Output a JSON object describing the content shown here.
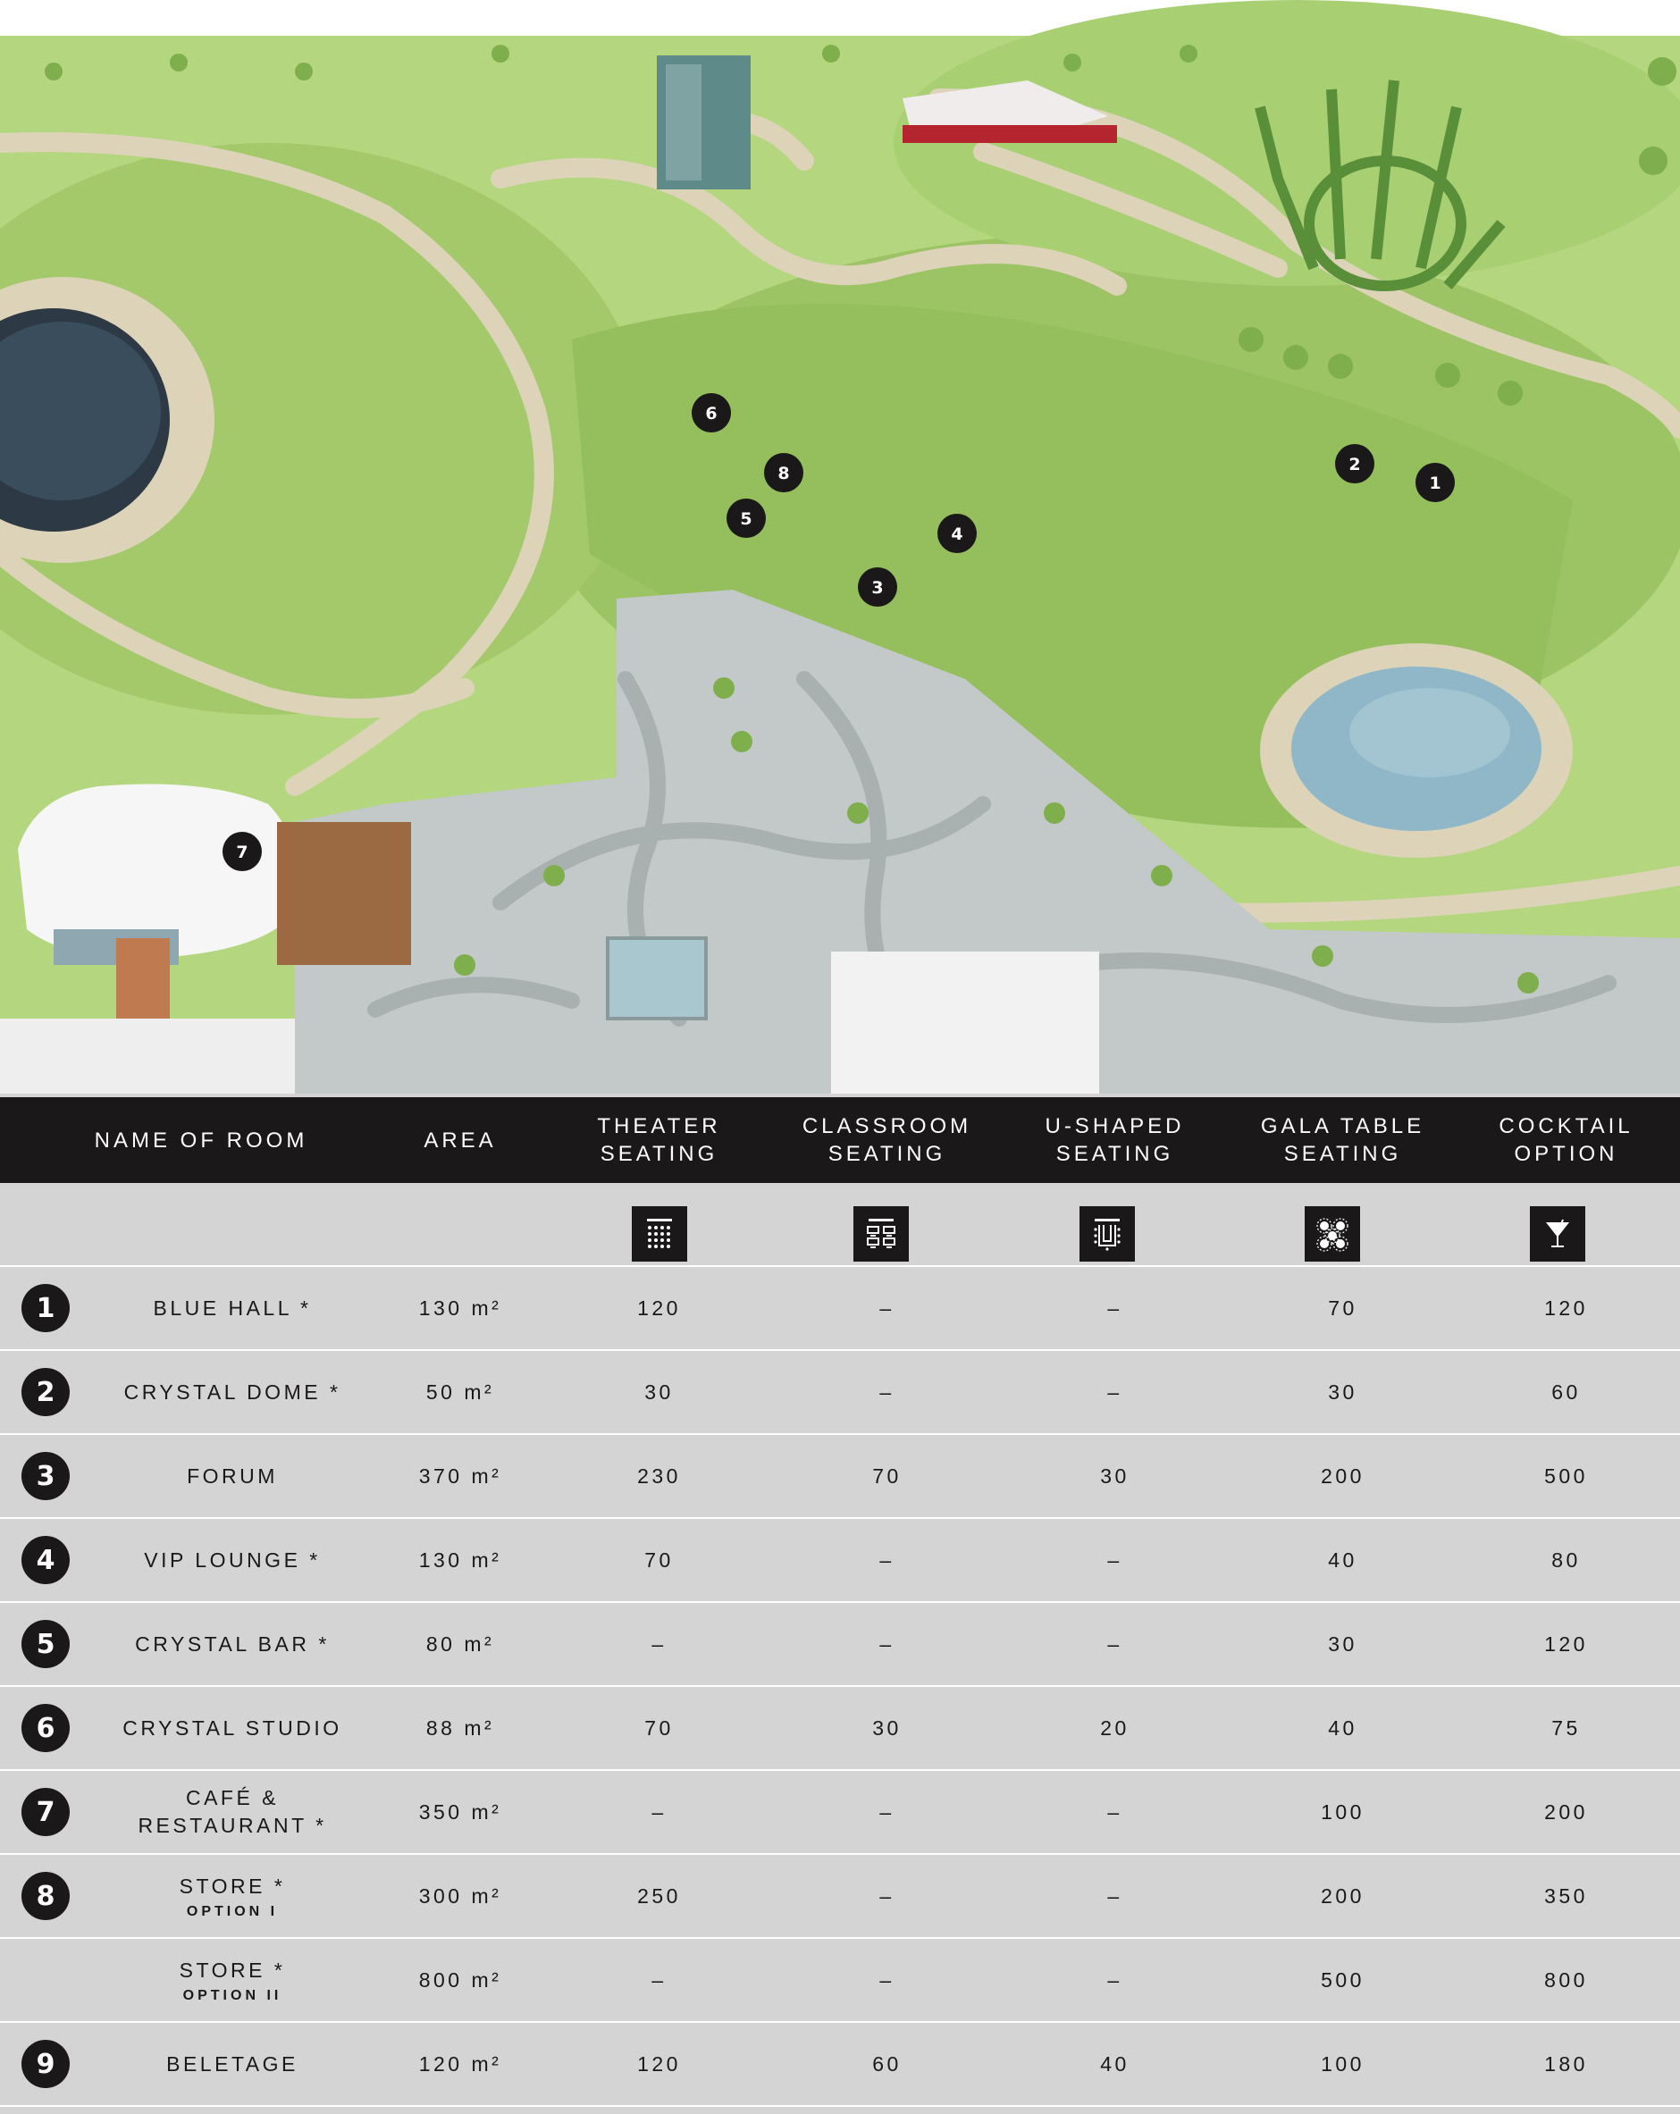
{
  "colors": {
    "grass": "#a9cf73",
    "path": "#dcd3b8",
    "plaza": "#c3c9c8",
    "water": "#8fb7c7",
    "header_bg": "#1a1818",
    "table_bg": "#d4d4d4",
    "marker": "#1a1818"
  },
  "map": {
    "markers": [
      "6",
      "8",
      "5",
      "4",
      "3",
      "2",
      "1",
      "7"
    ]
  },
  "table": {
    "headers": [
      "NAME OF ROOM",
      "AREA",
      "THEATER\nSEATING",
      "CLASSROOM\nSEATING",
      "U-SHAPED\nSEATING",
      "GALA TABLE\nSEATING",
      "COCKTAIL\nOPTION"
    ],
    "icons": [
      "theater-seating-icon",
      "classroom-seating-icon",
      "u-shaped-seating-icon",
      "gala-table-icon",
      "cocktail-glass-icon"
    ],
    "rows": [
      {
        "num": "1",
        "name": "BLUE HALL *",
        "sub": "",
        "area": "130 m²",
        "theater": "120",
        "classroom": "–",
        "ushaped": "–",
        "gala": "70",
        "cocktail": "120"
      },
      {
        "num": "2",
        "name": "CRYSTAL DOME *",
        "sub": "",
        "area": "50 m²",
        "theater": "30",
        "classroom": "–",
        "ushaped": "–",
        "gala": "30",
        "cocktail": "60"
      },
      {
        "num": "3",
        "name": "FORUM",
        "sub": "",
        "area": "370 m²",
        "theater": "230",
        "classroom": "70",
        "ushaped": "30",
        "gala": "200",
        "cocktail": "500"
      },
      {
        "num": "4",
        "name": "VIP LOUNGE *",
        "sub": "",
        "area": "130 m²",
        "theater": "70",
        "classroom": "–",
        "ushaped": "–",
        "gala": "40",
        "cocktail": "80"
      },
      {
        "num": "5",
        "name": "CRYSTAL BAR *",
        "sub": "",
        "area": "80 m²",
        "theater": "–",
        "classroom": "–",
        "ushaped": "–",
        "gala": "30",
        "cocktail": "120"
      },
      {
        "num": "6",
        "name": "CRYSTAL STUDIO",
        "sub": "",
        "area": "88 m²",
        "theater": "70",
        "classroom": "30",
        "ushaped": "20",
        "gala": "40",
        "cocktail": "75"
      },
      {
        "num": "7",
        "name": "CAFÉ &\nRESTAURANT *",
        "sub": "",
        "area": "350 m²",
        "theater": "–",
        "classroom": "–",
        "ushaped": "–",
        "gala": "100",
        "cocktail": "200"
      },
      {
        "num": "8",
        "name": "STORE *",
        "sub": "OPTION I",
        "area": "300 m²",
        "theater": "250",
        "classroom": "–",
        "ushaped": "–",
        "gala": "200",
        "cocktail": "350"
      },
      {
        "num": "",
        "name": "STORE *",
        "sub": "OPTION II",
        "area": "800 m²",
        "theater": "–",
        "classroom": "–",
        "ushaped": "–",
        "gala": "500",
        "cocktail": "800"
      },
      {
        "num": "9",
        "name": "BELETAGE",
        "sub": "",
        "area": "120 m²",
        "theater": "120",
        "classroom": "60",
        "ushaped": "40",
        "gala": "100",
        "cocktail": "180"
      }
    ]
  }
}
